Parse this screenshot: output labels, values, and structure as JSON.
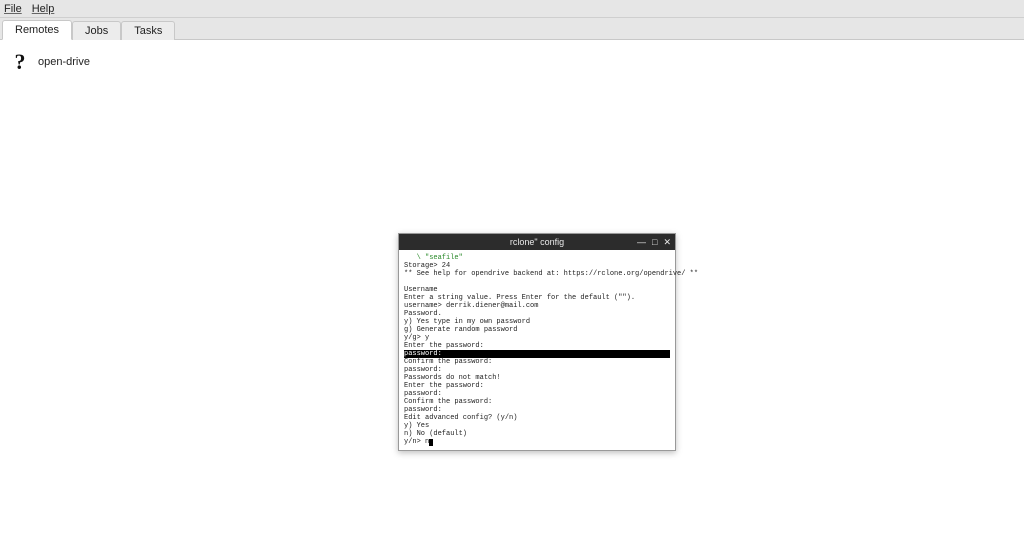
{
  "menubar": {
    "file": "File",
    "help": "Help"
  },
  "tabs": {
    "remotes": "Remotes",
    "jobs": "Jobs",
    "tasks": "Tasks"
  },
  "remote_item": {
    "icon": "?",
    "label": "open-drive"
  },
  "terminal": {
    "title": "rclone\" config",
    "controls": {
      "min": "—",
      "max": "□",
      "close": "✕"
    },
    "lines": {
      "l1_green": "   \\ \"seafile\"",
      "l2": "Storage> 24",
      "l3": "** See help for opendrive backend at: https://rclone.org/opendrive/ **",
      "blank1": "",
      "l4": "Username",
      "l5": "Enter a string value. Press Enter for the default (\"\").",
      "l6": "username> derrik.diener@mail.com",
      "l7": "Password.",
      "l8": "y) Yes type in my own password",
      "l9": "g) Generate random password",
      "l10": "y/g> y",
      "l11": "Enter the password:",
      "l12_hl": "password:",
      "l13": "Confirm the password:",
      "l14": "password:",
      "l15": "Passwords do not match!",
      "l16": "Enter the password:",
      "l17": "password:",
      "l18": "Confirm the password:",
      "l19": "password:",
      "l20": "Edit advanced config? (y/n)",
      "l21": "y) Yes",
      "l22": "n) No (default)",
      "l23_prompt": "y/n> n"
    }
  }
}
